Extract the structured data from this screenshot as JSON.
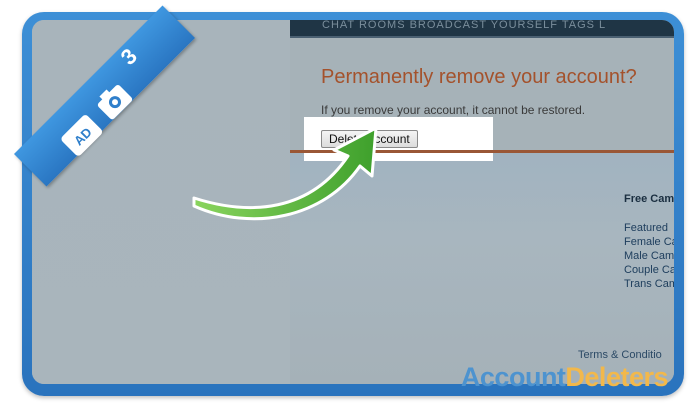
{
  "site": {
    "nav_text": "CHAT ROOMS    BROADCAST YOURSELF    TAGS    L",
    "panel": {
      "title": "Permanently remove your account?",
      "description": "If you remove your account, it cannot be restored.",
      "delete_button_label": "Delete Account"
    },
    "sidebar": {
      "heading": "Free Cams",
      "items": [
        "Featured",
        "Female Ca",
        "Male Cam",
        "Couple Ca",
        "Trans Cam"
      ]
    },
    "footer_link": "Terms & Conditio"
  },
  "tutorial": {
    "step_number": "3",
    "watermark_part1": "Account",
    "watermark_part2": "Deleters"
  },
  "colors": {
    "frame_blue": "#2f7fcb",
    "title_rust": "#a4522c",
    "arrow_green": "#5cc43a",
    "watermark_yellow": "#f2b84b"
  }
}
